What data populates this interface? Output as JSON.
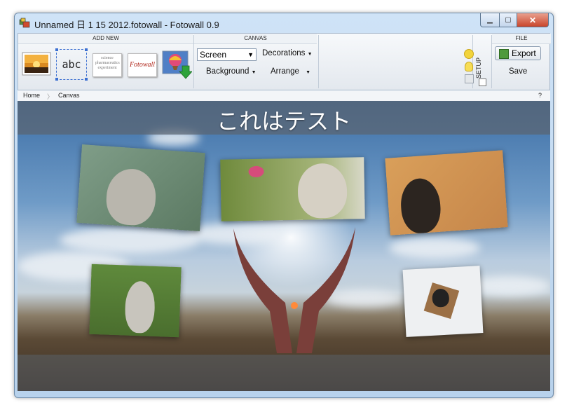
{
  "window": {
    "title": "Unnamed 日 1 15 2012.fotowall - Fotowall 0.9",
    "controls": {
      "minimize": "▁",
      "maximize": "▢",
      "close": "✕"
    }
  },
  "ribbon": {
    "groups": {
      "add_new": "ADD NEW",
      "canvas": "CANVAS",
      "file": "FILE"
    },
    "add_new": {
      "text_tool_label": "abc",
      "wordcloud_label": "science pharmaceutics experiment",
      "fotowall_tool_label": "Fotowall"
    },
    "canvas": {
      "screen_select": "Screen",
      "decorations": "Decorations",
      "background": "Background",
      "arrange": "Arrange"
    },
    "setup_label": "SETUP",
    "file": {
      "export": "Export",
      "save": "Save"
    }
  },
  "breadcrumb": {
    "home": "Home",
    "separator": "〉",
    "current": "Canvas",
    "help": "?"
  },
  "canvas": {
    "title_text": "これはテスト"
  },
  "colors": {
    "title_bar": "#c4dbf2",
    "close_button": "#c9452b",
    "ribbon": "#eef2f6",
    "canvas_band": "#5a6470"
  },
  "icons": {
    "app": "fotowall-app-icon",
    "dropdown": "chevron-down-icon",
    "smiley": "smiley-icon",
    "bulb": "lightbulb-icon",
    "export": "export-icon"
  }
}
